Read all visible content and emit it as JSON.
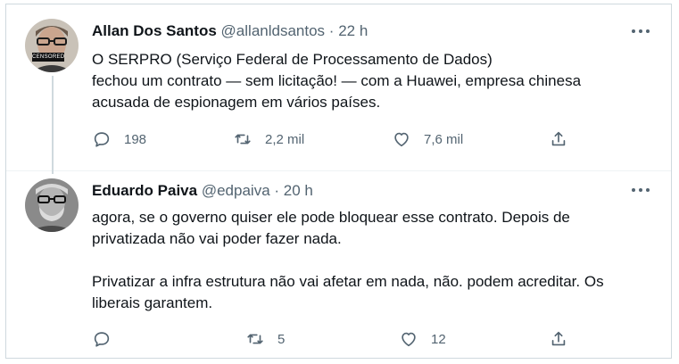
{
  "tweets": [
    {
      "name": "Allan Dos Santos",
      "handle": "@allanldsantos",
      "separator": "·",
      "time": "22 h",
      "text": "O SERPRO (Serviço Federal de Processamento de Dados)\nfechou um contrato — sem licitação! — com a Huawei, empresa chinesa\nacusada de espionagem em vários países.",
      "avatar_badge": "CENSORED",
      "replies": "198",
      "retweets": "2,2 mil",
      "likes": "7,6 mil"
    },
    {
      "name": "Eduardo Paiva",
      "handle": "@edpaiva",
      "separator": "·",
      "time": "20 h",
      "text": "agora, se o governo quiser ele pode bloquear esse contrato. Depois de\nprivatizada não vai poder fazer nada.\n\nPrivatizar a infra estrutura não vai afetar em nada, não. podem acreditar. Os\nliberais garantem.",
      "replies": "",
      "retweets": "5",
      "likes": "12"
    }
  ],
  "icons": {
    "reply": "reply-icon",
    "retweet": "retweet-icon",
    "like": "heart-icon",
    "share": "share-icon",
    "more": "more-options-icon"
  },
  "colors": {
    "text": "#0f1419",
    "secondary": "#536471",
    "border": "#cfd9de"
  }
}
